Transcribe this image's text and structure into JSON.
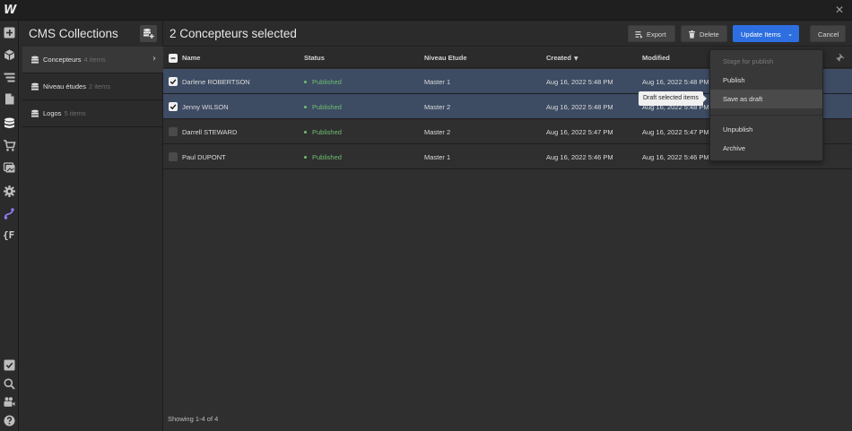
{
  "app": {
    "logo_text": "W"
  },
  "colors": {
    "accent": "#2d6fe0",
    "selected_row": "#3d4b63",
    "published": "#6fbd6f"
  },
  "rail": {
    "top_icons": [
      "add-panel-icon",
      "components-icon",
      "navigator-icon",
      "pages-icon",
      "cms-icon",
      "ecommerce-icon",
      "assets-icon",
      "settings-icon",
      "logic-icon",
      "finsweet-icon"
    ],
    "bottom_icons": [
      "audit-icon",
      "search-icon",
      "video-icon",
      "help-icon"
    ],
    "finsweet_label": "{F"
  },
  "collections_panel": {
    "title": "CMS Collections",
    "items": [
      {
        "label": "Concepteurs",
        "count": "4 items",
        "active": true
      },
      {
        "label": "Niveau études",
        "count": "2 items",
        "active": false
      },
      {
        "label": "Logos",
        "count": "5 items",
        "active": false
      }
    ]
  },
  "main": {
    "title": "2 Concepteurs selected",
    "buttons": {
      "export": "Export",
      "delete": "Delete",
      "update_items": "Update Items",
      "cancel": "Cancel"
    },
    "columns": {
      "name": "Name",
      "status": "Status",
      "niveau": "Niveau Etude",
      "created": "Created",
      "modified": "Modified"
    },
    "rows": [
      {
        "name": "Darlene ROBERTSON",
        "status": "Published",
        "niveau": "Master 1",
        "created": "Aug 16, 2022 5:48 PM",
        "modified": "Aug 16, 2022 5:48 PM",
        "selected": true
      },
      {
        "name": "Jenny WILSON",
        "status": "Published",
        "niveau": "Master 2",
        "created": "Aug 16, 2022 5:48 PM",
        "modified": "Aug 16, 2022 5:48 PM",
        "selected": true
      },
      {
        "name": "Darrell STEWARD",
        "status": "Published",
        "niveau": "Master 2",
        "created": "Aug 16, 2022 5:47 PM",
        "modified": "Aug 16, 2022 5:47 PM",
        "selected": false
      },
      {
        "name": "Paul DUPONT",
        "status": "Published",
        "niveau": "Master 1",
        "created": "Aug 16, 2022 5:46 PM",
        "modified": "Aug 16, 2022 5:46 PM",
        "selected": false
      }
    ],
    "footer": "Showing 1-4 of 4"
  },
  "update_menu": {
    "items": [
      {
        "label": "Stage for publish",
        "disabled": true
      },
      {
        "label": "Publish",
        "disabled": false
      },
      {
        "label": "Save as draft",
        "disabled": false,
        "hover": true
      },
      {
        "label": "Unpublish",
        "disabled": false
      },
      {
        "label": "Archive",
        "disabled": false
      }
    ],
    "tooltip": "Draft selected items"
  }
}
